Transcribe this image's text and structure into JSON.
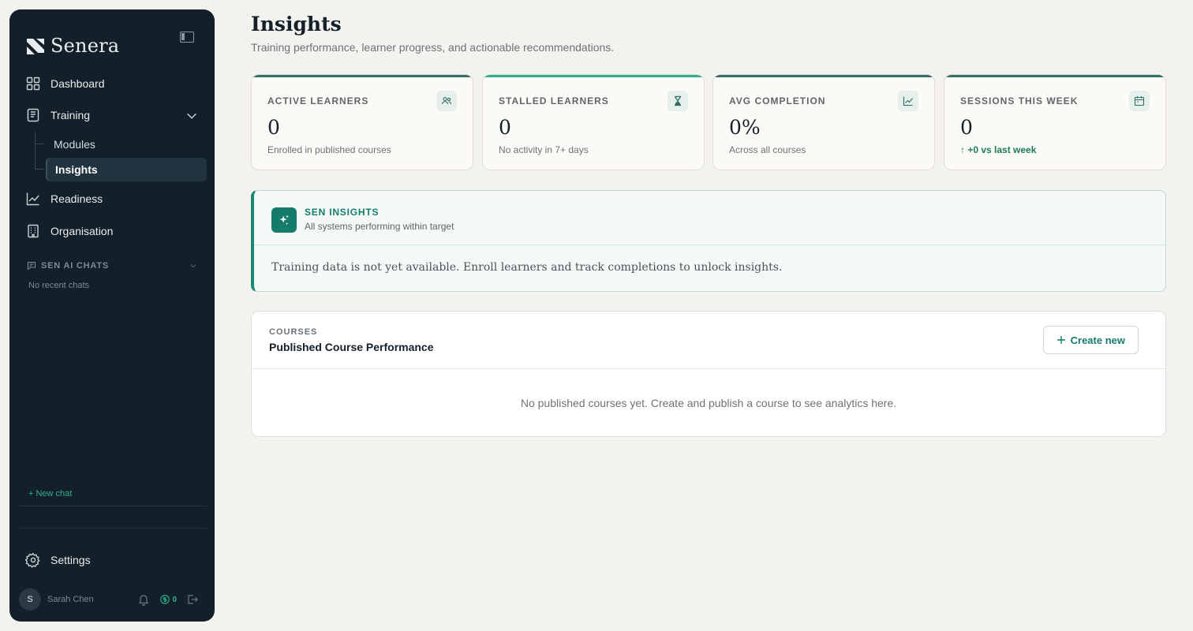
{
  "sidebar": {
    "brand": "Senera",
    "nav": {
      "dashboard": "Dashboard",
      "training": "Training",
      "modules": "Modules",
      "insights": "Insights",
      "readiness": "Readiness",
      "organisation": "Organisation",
      "settings": "Settings"
    },
    "chats": {
      "heading": "SEN AI CHATS",
      "empty": "No recent chats",
      "new_chat": "+ New chat"
    },
    "user": {
      "initial": "S",
      "name": "Sarah Chen",
      "credits": "0"
    }
  },
  "header": {
    "title": "Insights",
    "subtitle": "Training performance, learner progress, and actionable recommendations."
  },
  "kpis": [
    {
      "label": "ACTIVE LEARNERS",
      "value": "0",
      "desc": "Enrolled in published courses",
      "icon": "users-icon"
    },
    {
      "label": "STALLED LEARNERS",
      "value": "0",
      "desc": "No activity in 7+ days",
      "icon": "hourglass-icon"
    },
    {
      "label": "AVG COMPLETION",
      "value": "0%",
      "desc": "Across all courses",
      "icon": "line-chart-icon"
    },
    {
      "label": "SESSIONS THIS WEEK",
      "value": "0",
      "desc": "↑ +0 vs last week",
      "icon": "calendar-icon"
    }
  ],
  "sen_insights": {
    "title": "SEN INSIGHTS",
    "status": "All systems performing within target",
    "message": "Training data is not yet available. Enroll learners and track completions to unlock insights."
  },
  "courses": {
    "eyebrow": "COURSES",
    "title": "Published Course Performance",
    "create_label": "Create new",
    "empty": "No published courses yet. Create and publish a course to see analytics here."
  },
  "colors": {
    "sidebar_bg": "#13202a",
    "accent": "#157c6c",
    "accent_bright": "#2fb08c",
    "page_bg": "#f4f2ef"
  }
}
